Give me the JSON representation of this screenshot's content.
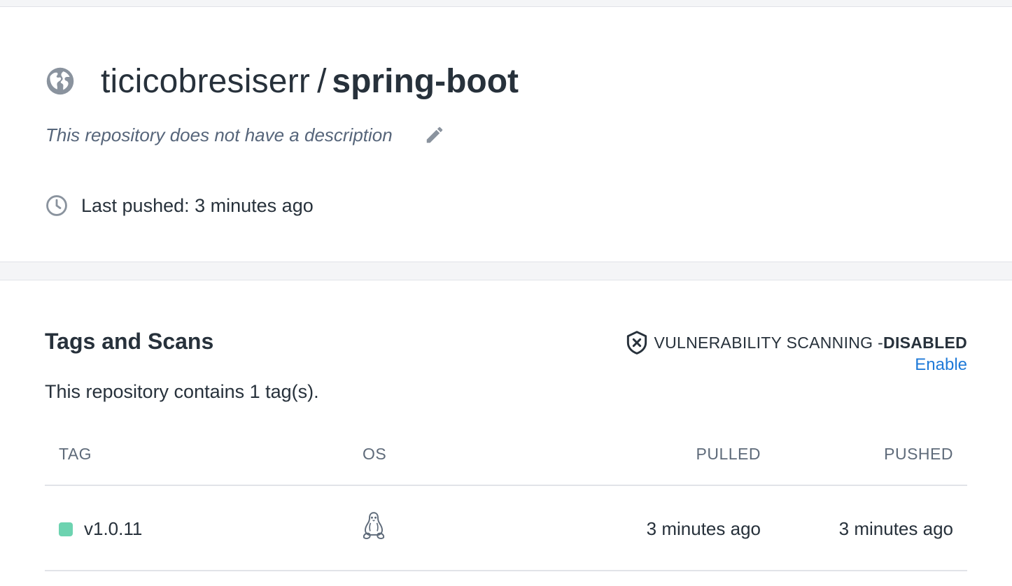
{
  "repository": {
    "namespace": "ticicobresiserr",
    "separator": "/",
    "name": "spring-boot",
    "visibility_icon": "globe-icon",
    "description": "This repository does not have a description",
    "last_pushed": "Last pushed: 3 minutes ago"
  },
  "tags_section": {
    "title": "Tags and Scans",
    "vulnerability_label": "VULNERABILITY SCANNING - ",
    "vulnerability_status": "DISABLED",
    "enable_label": "Enable",
    "tag_count_text": "This repository contains 1 tag(s).",
    "columns": {
      "tag": "TAG",
      "os": "OS",
      "pulled": "PULLED",
      "pushed": "PUSHED"
    },
    "rows": [
      {
        "tag": "v1.0.11",
        "os_icon": "linux-icon",
        "pulled": "3 minutes ago",
        "pushed": "3 minutes ago",
        "status_color": "#6dd3b0"
      }
    ]
  },
  "colors": {
    "accent_link": "#1f7ad8",
    "text": "#27313b",
    "muted": "#56657a",
    "divider": "#e1e3e8"
  }
}
